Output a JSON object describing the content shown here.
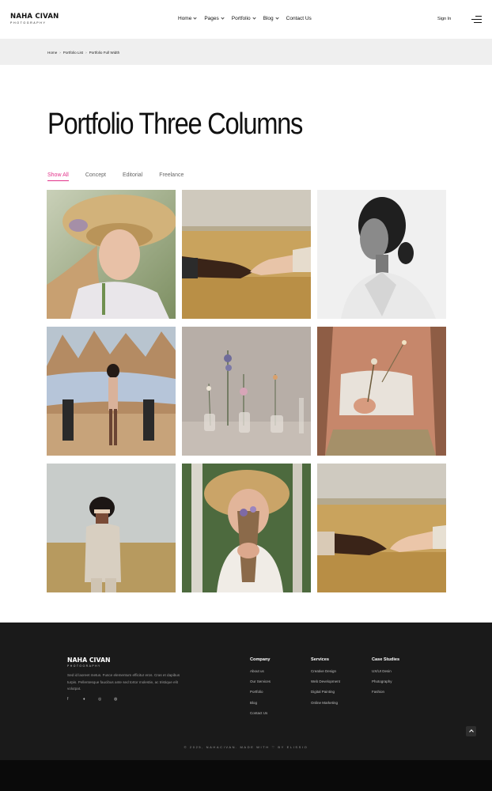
{
  "brand": {
    "name": "NAHA CIVAN",
    "tagline": "PHOTOGRAPHY"
  },
  "nav": {
    "items": [
      {
        "label": "Home",
        "has_dropdown": true
      },
      {
        "label": "Pages",
        "has_dropdown": true
      },
      {
        "label": "Portfolio",
        "has_dropdown": true
      },
      {
        "label": "Blog",
        "has_dropdown": true
      },
      {
        "label": "Contact Us",
        "has_dropdown": false
      }
    ],
    "signin": "Sign In",
    "menu_icon": "hamburger-menu-icon"
  },
  "breadcrumb": {
    "items": [
      "Home",
      "Portfolio List",
      "Portfolio Full Width"
    ],
    "separator": "›"
  },
  "page": {
    "title": "Portfolio Three Columns"
  },
  "filters": {
    "items": [
      "Show All",
      "Concept",
      "Editorial",
      "Freelance"
    ],
    "active": "Show All"
  },
  "portfolio": {
    "items": [
      {
        "subject": "woman-straw-hat-flowers"
      },
      {
        "subject": "hands-reaching-wheat-field"
      },
      {
        "subject": "woman-portrait-black-white"
      },
      {
        "subject": "model-blue-fabric-desert"
      },
      {
        "subject": "flowers-glass-vases"
      },
      {
        "subject": "woman-holding-flowers-closeup"
      },
      {
        "subject": "man-suit-field-eyes-covered"
      },
      {
        "subject": "woman-hat-bouquet-forest"
      },
      {
        "subject": "hands-touching-wheat-field"
      }
    ]
  },
  "footer": {
    "brand": {
      "name": "NAHA CIVAN",
      "tagline": "PHOTOGRAPHY"
    },
    "description": "Sed id laoreet metus. Fusce elementum efficitur eros. Cras et dapibus turpis. Pellentesque faucibus ante sed tortor molestie, ac tristique elit volutpat.",
    "social": [
      {
        "icon": "facebook-icon",
        "glyph": "f"
      },
      {
        "icon": "twitter-icon",
        "glyph": "♦"
      },
      {
        "icon": "instagram-icon",
        "glyph": "◎"
      },
      {
        "icon": "dribbble-icon",
        "glyph": "◍"
      }
    ],
    "columns": [
      {
        "title": "Company",
        "links": [
          "About us",
          "Our Services",
          "Portfolio",
          "Blog",
          "Contact Us"
        ]
      },
      {
        "title": "Services",
        "links": [
          "Creative Design",
          "Web Development",
          "Digital Painting",
          "Online Marketing"
        ]
      },
      {
        "title": "Case Studies",
        "links": [
          "UX/UI Desin",
          "Photography",
          "Fashion"
        ]
      }
    ],
    "copyright": "© 2025, NAHACIVAN. MADE WITH ♡ BY ELISSIO",
    "back_to_top_icon": "chevron-up-icon"
  }
}
